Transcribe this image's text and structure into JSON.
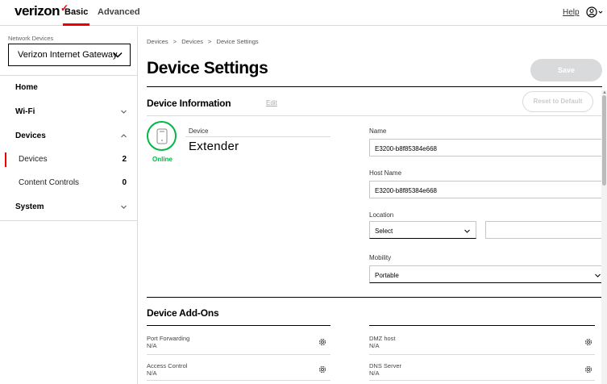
{
  "header": {
    "brand": "verizon",
    "brand_mark": "✓",
    "nav": [
      {
        "label": "Basic"
      },
      {
        "label": "Advanced"
      }
    ],
    "help_label": "Help",
    "user_icon": "user-circle-icon"
  },
  "sidebar": {
    "device_selector_caption": "Network Devices",
    "device_selector_value": "Verizon Internet Gateway",
    "items": [
      {
        "label": "Home"
      },
      {
        "label": "Wi-Fi"
      },
      {
        "label": "Devices"
      },
      {
        "label": "Devices",
        "count": "2"
      },
      {
        "label": "Content Controls",
        "count": "0"
      },
      {
        "label": "System"
      }
    ]
  },
  "main": {
    "breadcrumb": [
      "Devices",
      ">",
      "Devices",
      ">",
      "Device Settings"
    ],
    "title": "Device Settings",
    "save_label": "Save",
    "device_info": {
      "title": "Device Information",
      "edit_label": "Edit",
      "reset_label": "Reset to Default",
      "device_label": "Device",
      "device_value": "Extender",
      "status": "Online",
      "status_color": "#00b845",
      "name_label": "Name",
      "name_value": "E3200-b8f85384e668",
      "host_label": "Host Name",
      "host_value": "E3200-b8f85384e668",
      "location_label": "Location",
      "location_value": "Select",
      "mobility_label": "Mobility",
      "mobility_value": "Portable"
    },
    "addons": {
      "title": "Device Add-Ons",
      "items": [
        {
          "label": "Port Forwarding",
          "value": "N/A"
        },
        {
          "label": "DMZ host",
          "value": "N/A"
        },
        {
          "label": "Access Control",
          "value": "N/A"
        },
        {
          "label": "DNS Server",
          "value": "N/A"
        }
      ]
    }
  },
  "colors": {
    "accent": "#ee0000",
    "online": "#00b845",
    "disabled": "#d8dadb"
  }
}
